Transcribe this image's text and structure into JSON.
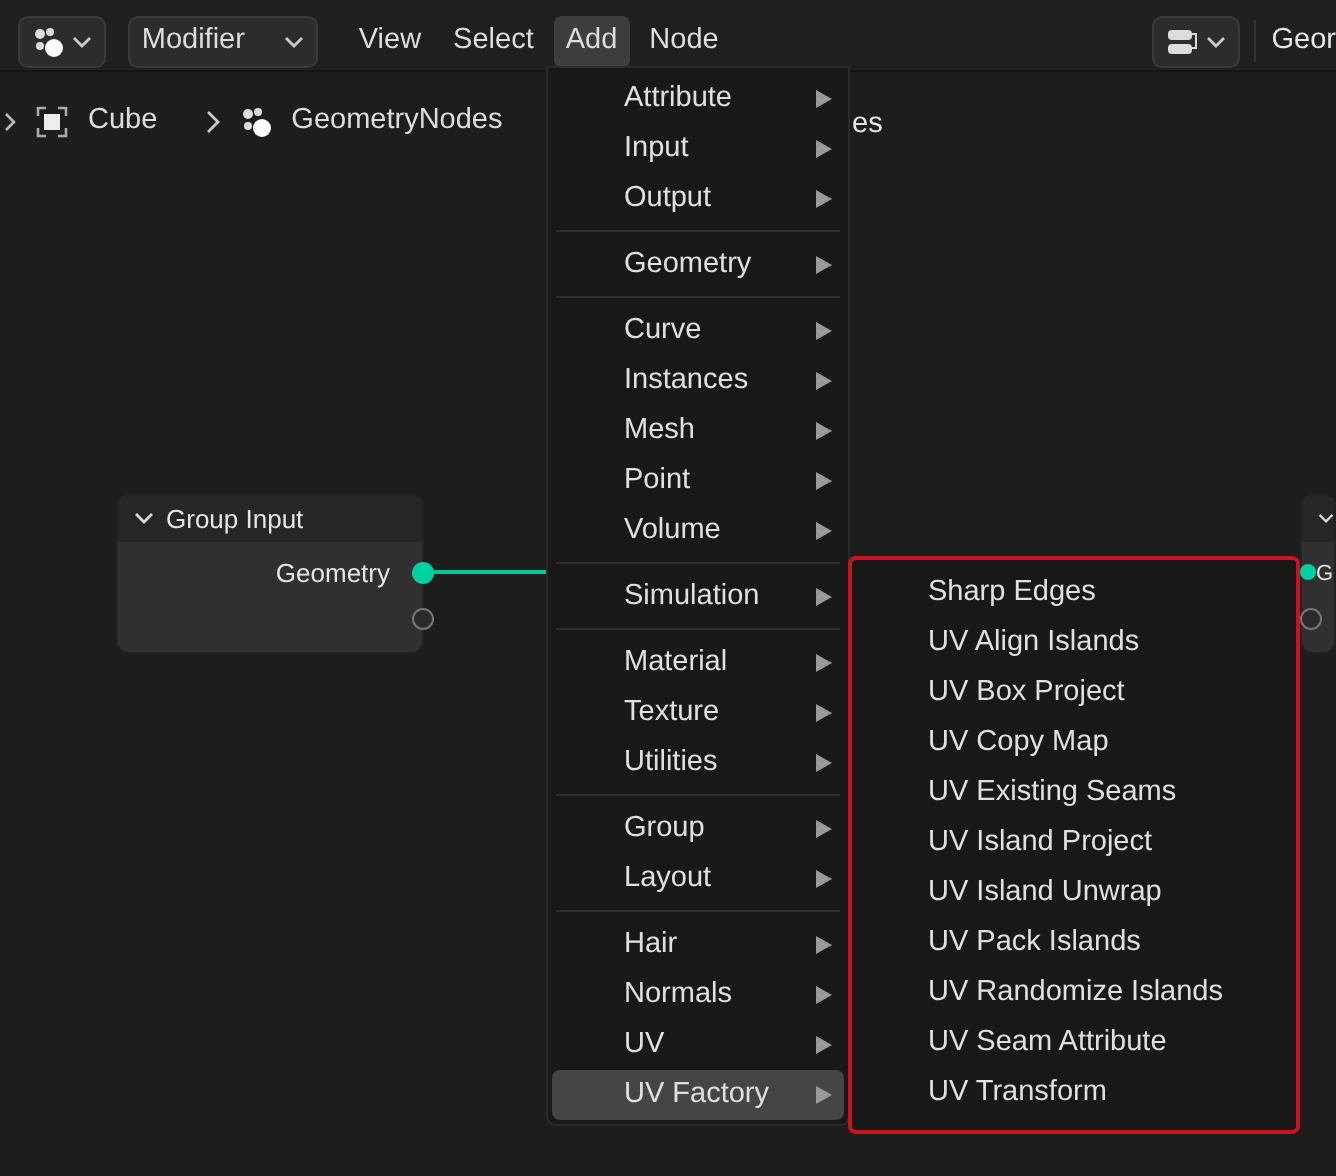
{
  "header": {
    "mode_dropdown": "Modifier",
    "menus": [
      {
        "label": "View",
        "selected": false
      },
      {
        "label": "Select",
        "selected": false
      },
      {
        "label": "Add",
        "selected": true
      },
      {
        "label": "Node",
        "selected": false
      }
    ],
    "right_field": "Geor"
  },
  "breadcrumb": {
    "object": "Cube",
    "modifier": "GeometryNodes",
    "trailing_text": "es"
  },
  "nodes": [
    {
      "title": "Group Input",
      "sockets": [
        {
          "label": "Geometry",
          "connected": true
        },
        {
          "connected": false
        }
      ]
    },
    {
      "sockets": [
        {
          "label": "G",
          "connected": true
        },
        {
          "connected": false
        }
      ]
    }
  ],
  "add_menu": {
    "groups": [
      [
        {
          "label": "Attribute",
          "selected": false
        },
        {
          "label": "Input",
          "selected": false
        },
        {
          "label": "Output",
          "selected": false
        }
      ],
      [
        {
          "label": "Geometry",
          "selected": false
        }
      ],
      [
        {
          "label": "Curve",
          "selected": false
        },
        {
          "label": "Instances",
          "selected": false
        },
        {
          "label": "Mesh",
          "selected": false
        },
        {
          "label": "Point",
          "selected": false
        },
        {
          "label": "Volume",
          "selected": false
        }
      ],
      [
        {
          "label": "Simulation",
          "selected": false
        }
      ],
      [
        {
          "label": "Material",
          "selected": false
        },
        {
          "label": "Texture",
          "selected": false
        },
        {
          "label": "Utilities",
          "selected": false
        }
      ],
      [
        {
          "label": "Group",
          "selected": false
        },
        {
          "label": "Layout",
          "selected": false
        }
      ],
      [
        {
          "label": "Hair",
          "selected": false
        },
        {
          "label": "Normals",
          "selected": false
        },
        {
          "label": "UV",
          "selected": false
        },
        {
          "label": "UV Factory",
          "selected": true
        }
      ]
    ]
  },
  "submenu": {
    "highlighted": true,
    "items": [
      "Sharp Edges",
      "UV Align Islands",
      "UV Box Project",
      "UV Copy Map",
      "UV Existing Seams",
      "UV Island Project",
      "UV Island Unwrap",
      "UV Pack Islands",
      "UV Randomize Islands",
      "UV Seam Attribute",
      "UV Transform"
    ]
  }
}
